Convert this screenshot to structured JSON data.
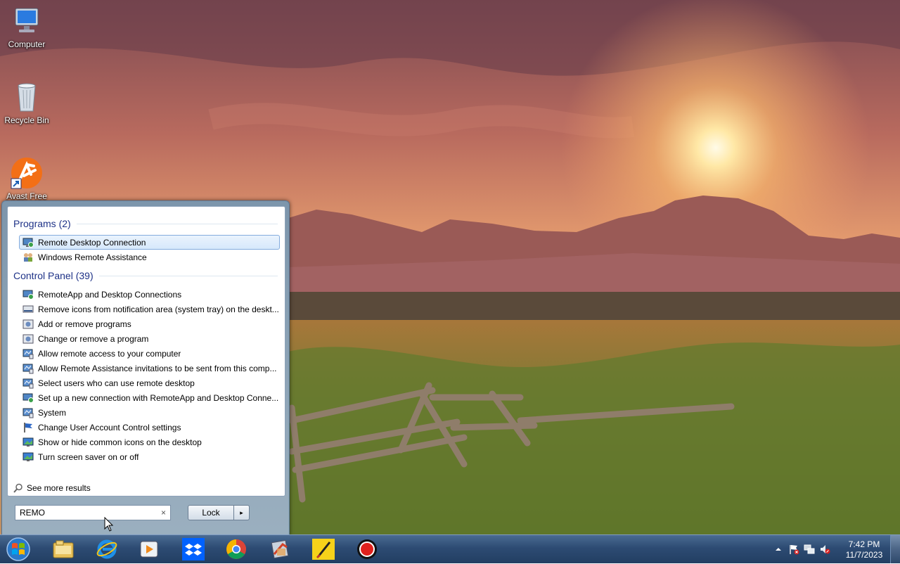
{
  "desktop": {
    "icons": [
      {
        "label": "Computer",
        "icon": "computer-icon"
      },
      {
        "label": "Recycle Bin",
        "icon": "recycle-bin-icon"
      },
      {
        "label": "Avast Free",
        "icon": "avast-icon"
      }
    ]
  },
  "start_menu": {
    "groups": [
      {
        "title": "Programs (2)",
        "items": [
          {
            "label": "Remote Desktop Connection",
            "icon": "remote-desktop-icon",
            "selected": true
          },
          {
            "label": "Windows Remote Assistance",
            "icon": "remote-assistance-icon",
            "selected": false
          }
        ]
      },
      {
        "title": "Control Panel (39)",
        "items": [
          {
            "label": "RemoteApp and Desktop Connections",
            "icon": "remoteapp-icon"
          },
          {
            "label": "Remove icons from notification area (system tray) on the deskt...",
            "icon": "notification-area-icon"
          },
          {
            "label": "Add or remove programs",
            "icon": "programs-icon"
          },
          {
            "label": "Change or remove a program",
            "icon": "programs-icon"
          },
          {
            "label": "Allow remote access to your computer",
            "icon": "system-icon"
          },
          {
            "label": "Allow Remote Assistance invitations to be sent from this comp...",
            "icon": "system-icon"
          },
          {
            "label": "Select users who can use remote desktop",
            "icon": "system-icon"
          },
          {
            "label": "Set up a new connection with RemoteApp and Desktop Conne...",
            "icon": "remoteapp-icon"
          },
          {
            "label": "System",
            "icon": "system-icon"
          },
          {
            "label": "Change User Account Control settings",
            "icon": "uac-flag-icon"
          },
          {
            "label": "Show or hide common icons on the desktop",
            "icon": "display-icon"
          },
          {
            "label": "Turn screen saver on or off",
            "icon": "display-icon"
          }
        ]
      }
    ],
    "see_more": "See more results",
    "search": {
      "value": "REMO",
      "clear_glyph": "×"
    },
    "lock": {
      "label": "Lock",
      "arrow": "▸"
    }
  },
  "taskbar": {
    "start": "start-orb-icon",
    "buttons": [
      {
        "name": "explorer",
        "icon": "folder-icon"
      },
      {
        "name": "internet-explorer",
        "icon": "ie-icon"
      },
      {
        "name": "media-player",
        "icon": "media-player-icon"
      },
      {
        "name": "dropbox",
        "icon": "dropbox-icon"
      },
      {
        "name": "chrome",
        "icon": "chrome-icon"
      },
      {
        "name": "app",
        "icon": "app-icon"
      },
      {
        "name": "sticky",
        "icon": "yellow-app-icon"
      },
      {
        "name": "recorder",
        "icon": "record-icon"
      }
    ],
    "tray": [
      "show-hidden-icon",
      "action-center-flag-icon",
      "network-icon",
      "volume-muted-icon"
    ],
    "clock": {
      "time": "7:42 PM",
      "date": "11/7/2023"
    }
  },
  "colors": {
    "accent_blue": "#1e3287",
    "selection_border": "#84acdd"
  }
}
